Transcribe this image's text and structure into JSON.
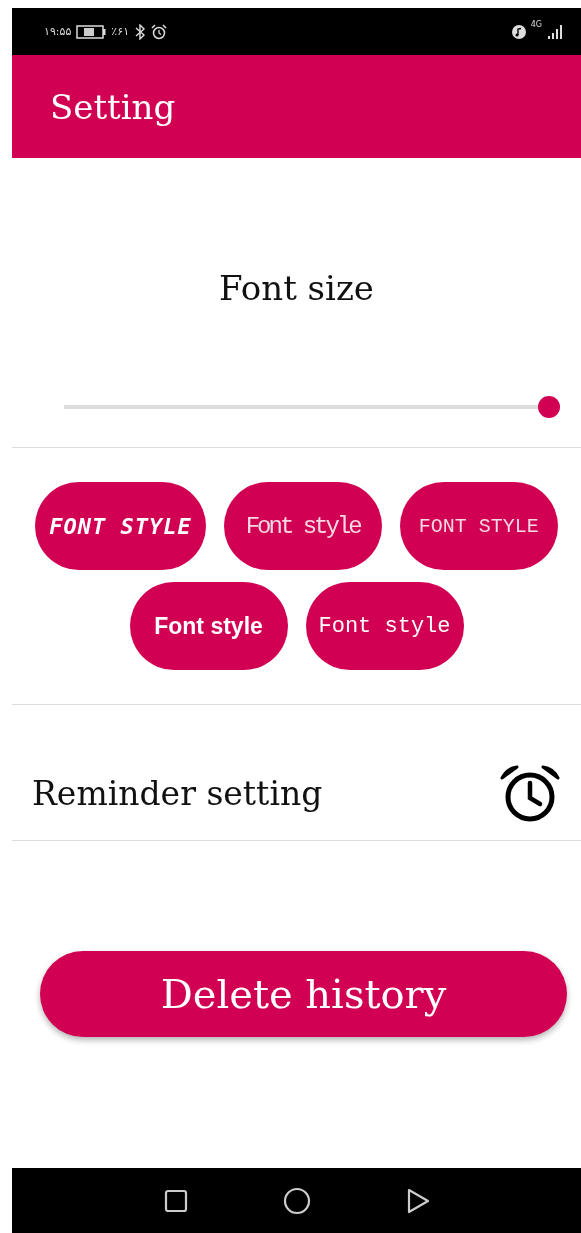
{
  "status_bar": {
    "time": "۱۹:۵۵",
    "battery": "٪۶۱",
    "network": "4G"
  },
  "app_bar": {
    "title": "Setting"
  },
  "font_size": {
    "label": "Font size",
    "level": 1
  },
  "font_styles": [
    {
      "label": "FONT STYLE",
      "kind": "digital"
    },
    {
      "label": "Font style",
      "kind": "condensed"
    },
    {
      "label": "FONT STYLE",
      "kind": "dotted"
    },
    {
      "label": "Font style",
      "kind": "bold"
    },
    {
      "label": "Font style",
      "kind": "mono"
    }
  ],
  "reminder": {
    "label": "Reminder setting"
  },
  "delete_button": {
    "label": "Delete history"
  }
}
